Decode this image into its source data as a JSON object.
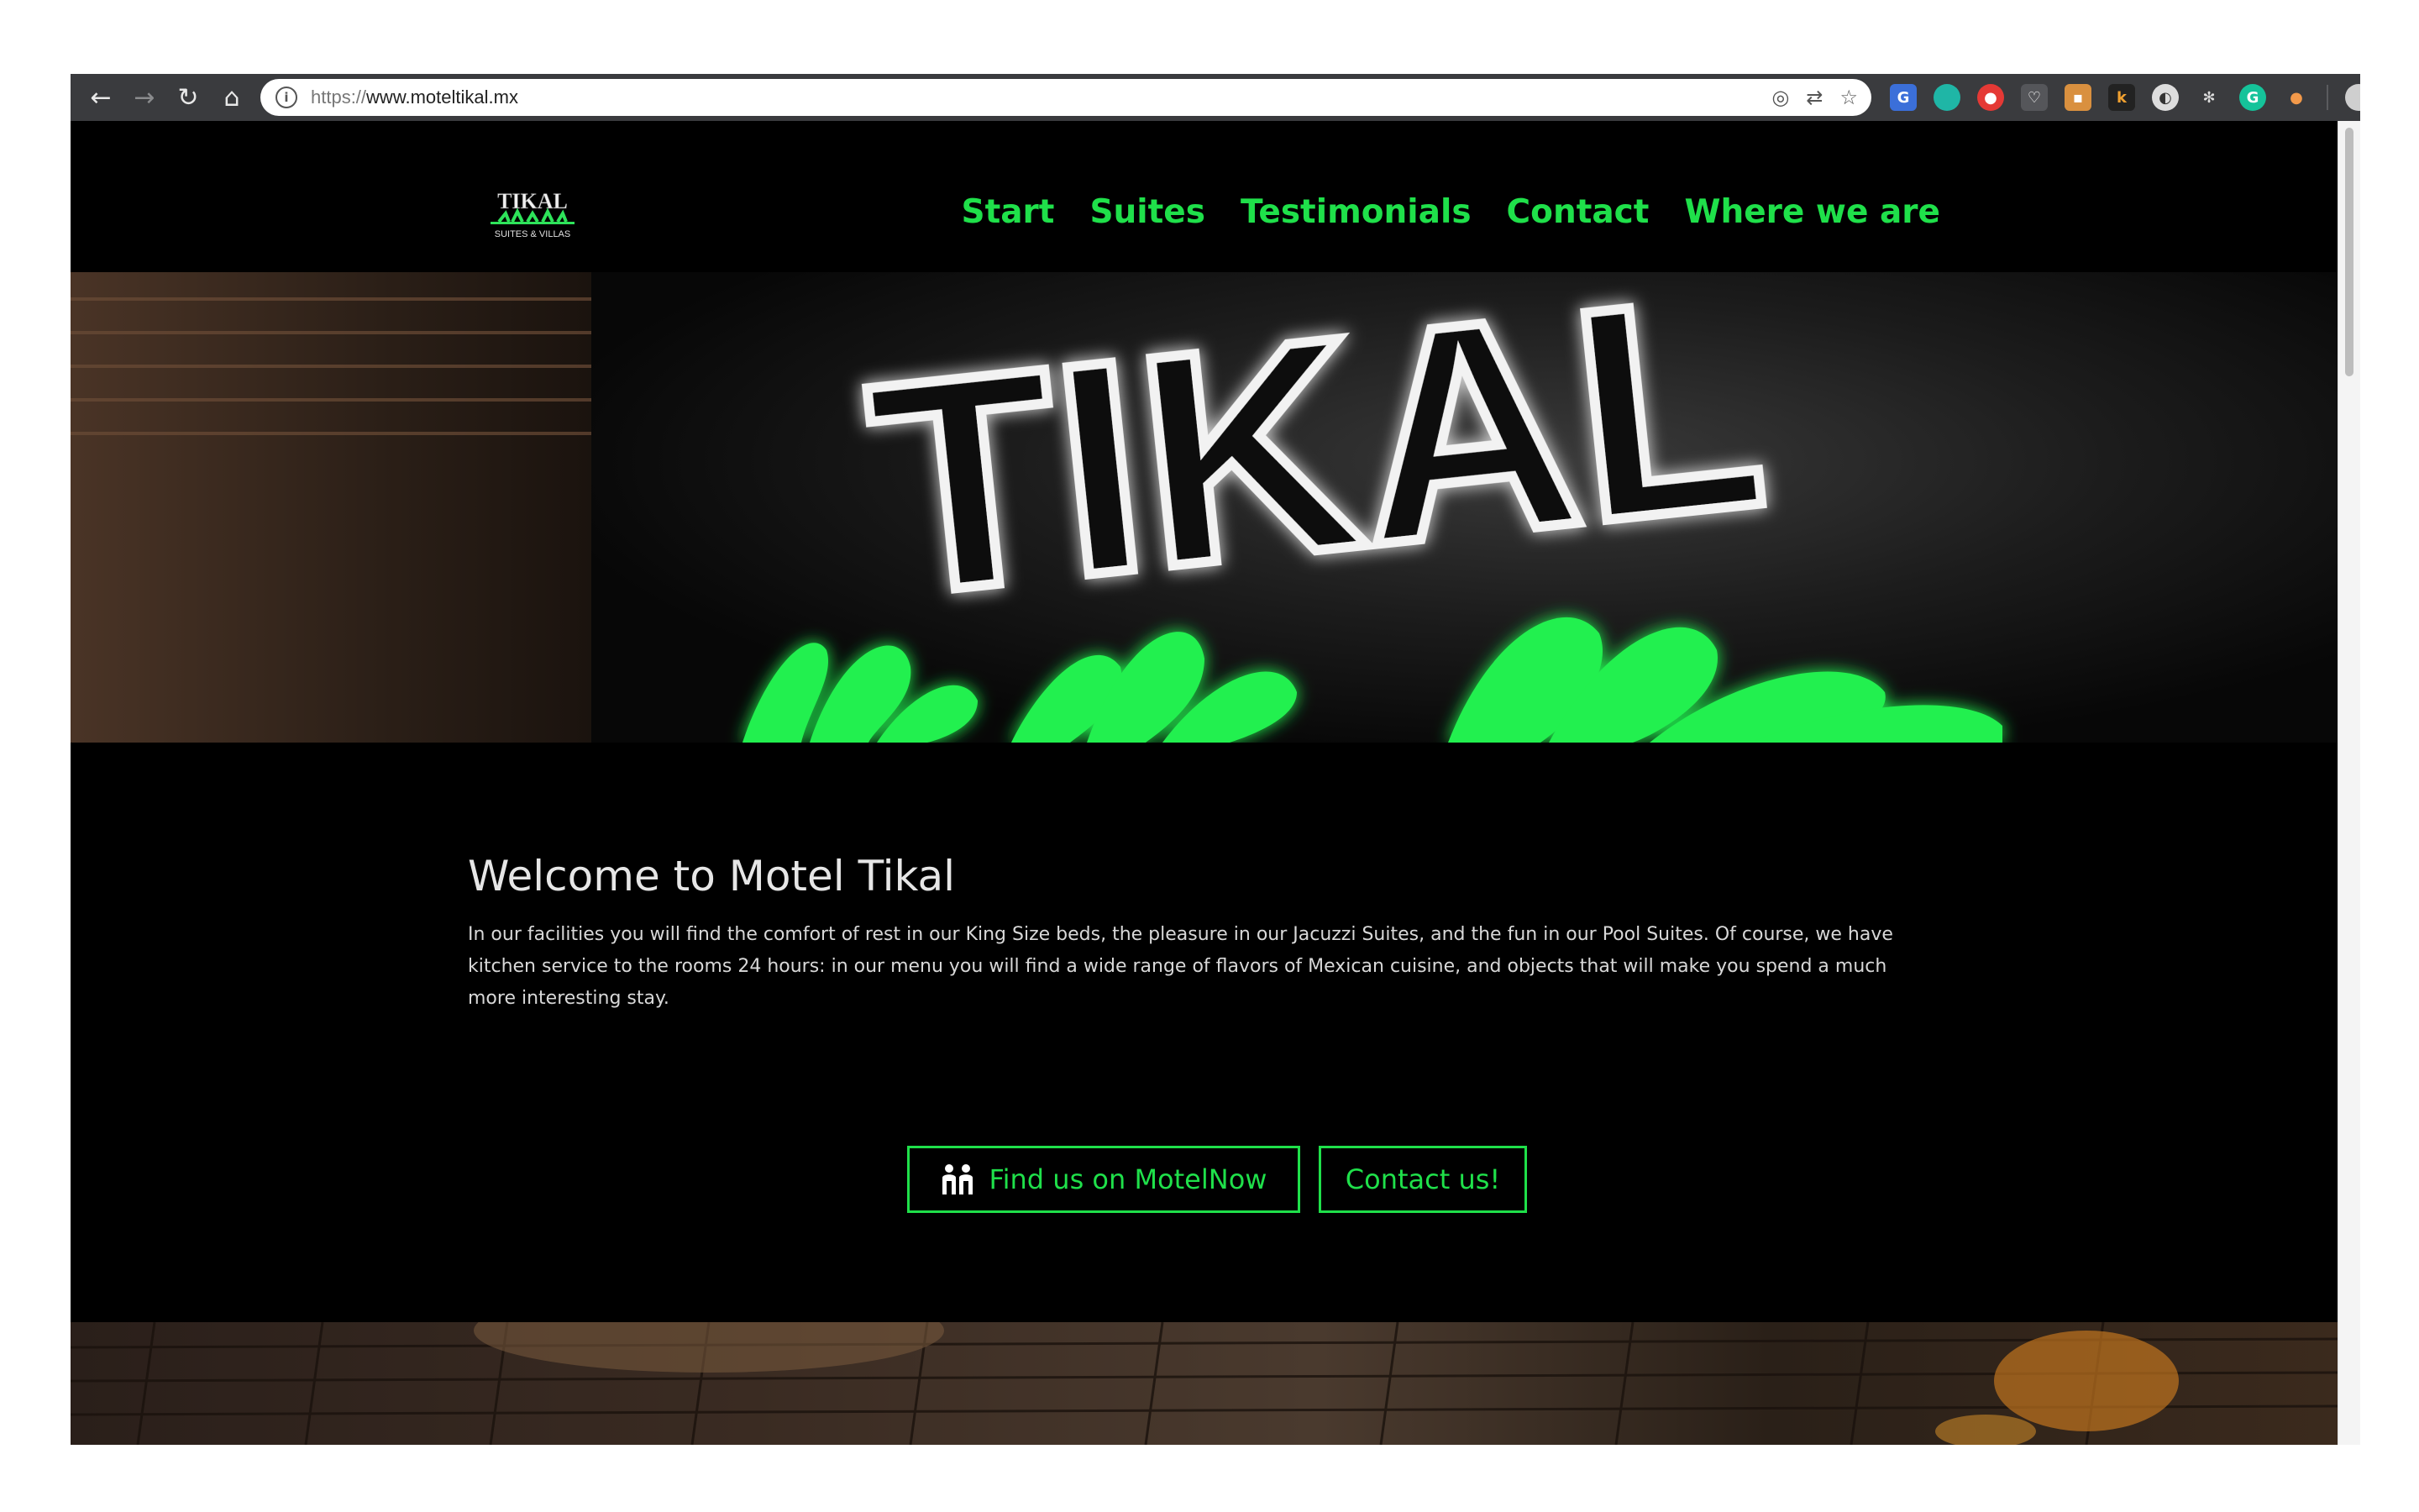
{
  "browser": {
    "url_scheme": "https://",
    "url_host": "www.moteltikal.mx",
    "icons": [
      "back-arrow-icon",
      "forward-arrow-icon",
      "reload-icon",
      "home-icon",
      "info-icon",
      "bookmark-star-icon"
    ]
  },
  "site": {
    "logo_text": "TIKAL",
    "logo_subtext": "SUITES & VILLAS",
    "nav": [
      "Start",
      "Suites",
      "Testimonials",
      "Contact",
      "Where we are"
    ]
  },
  "hero": {
    "sign_text": "TIKAL"
  },
  "welcome": {
    "title": "Welcome to Motel Tikal",
    "body": "In our facilities you will find the comfort of rest in our King Size beds, the pleasure in our Jacuzzi Suites, and the fun in our Pool Suites. Of course, we have kitchen service to the rooms 24 hours: in our menu you will find a wide range of flavors of Mexican cuisine, and objects that will make you spend a much more interesting stay."
  },
  "buttons": {
    "motelnow": "Find us on MotelNow",
    "contact": "Contact us!"
  },
  "colors": {
    "accent": "#1fe04a",
    "page_bg": "#000000",
    "toolbar_bg": "#3a3b3e"
  }
}
